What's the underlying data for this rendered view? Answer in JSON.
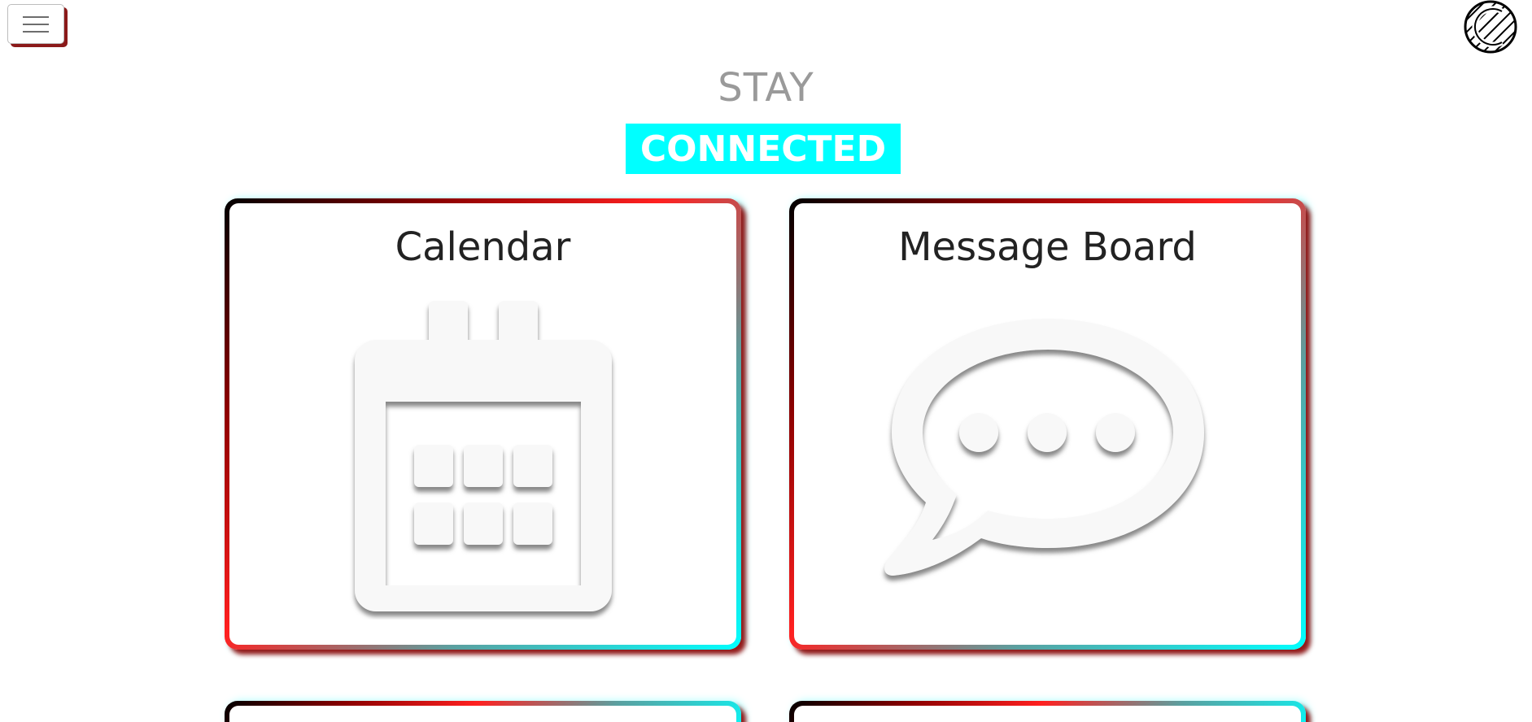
{
  "header": {
    "line1": "STAY",
    "line2": "CONNECTED"
  },
  "menu": {
    "icon": "hamburger-menu-icon"
  },
  "logo": {
    "icon": "striped-circle-logo"
  },
  "cards": [
    {
      "title": "Calendar",
      "icon": "calendar-icon"
    },
    {
      "title": "Message Board",
      "icon": "speech-bubble-icon"
    }
  ],
  "colors": {
    "accent": "#00ffff",
    "shadow_red": "#8b1a1a",
    "gradient": [
      "#000000",
      "#8b0000",
      "#ff2020",
      "#5aa0a0",
      "#00ffff"
    ],
    "header_gray": "#9a9a9a",
    "icon_white": "#f8f8f8"
  }
}
